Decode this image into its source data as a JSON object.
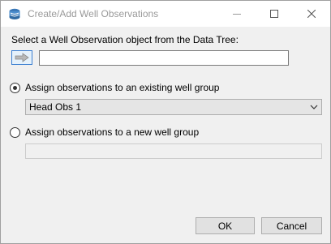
{
  "window": {
    "title": "Create/Add Well Observations"
  },
  "picker": {
    "label": "Select a Well Observation object from the Data Tree:",
    "value": ""
  },
  "options": {
    "existing": {
      "label": "Assign observations to an existing well group",
      "selected": true
    },
    "existing_group": {
      "value": "Head Obs 1"
    },
    "new": {
      "label": "Assign observations to a new well group",
      "selected": false
    },
    "new_group": {
      "value": ""
    }
  },
  "buttons": {
    "ok": "OK",
    "cancel": "Cancel"
  },
  "icons": {
    "app": "well-observation-app-icon",
    "select_arrow": "right-arrow-icon",
    "minimize": "minimize-icon",
    "maximize": "maximize-icon",
    "close": "close-icon",
    "dropdown": "chevron-down-icon"
  },
  "colors": {
    "arrow_button_border": "#3c7fd1",
    "arrow_fill": "#b8b8b8",
    "background": "#f0f0f0"
  }
}
